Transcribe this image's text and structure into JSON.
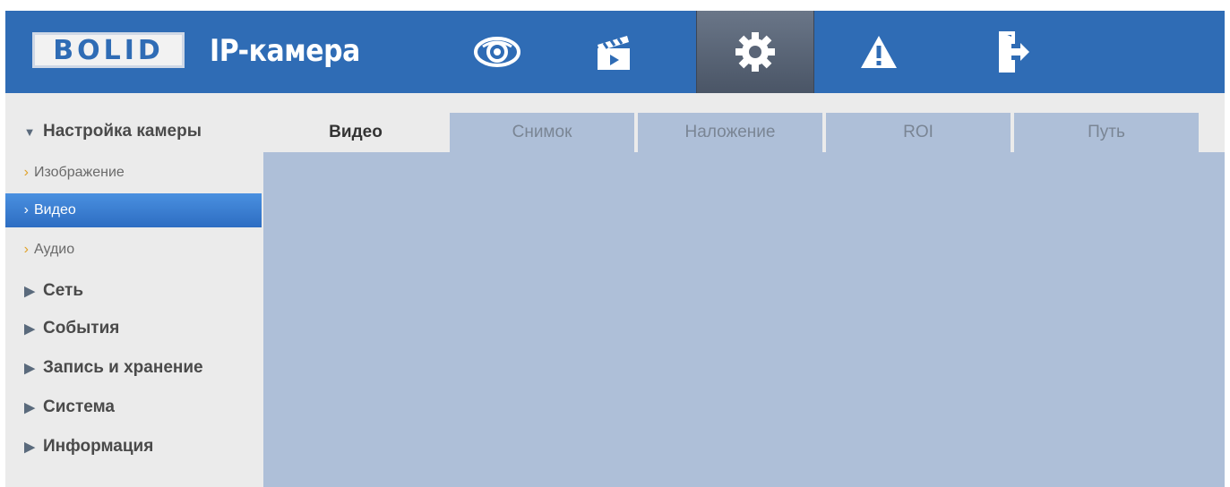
{
  "header": {
    "logo_text": "BOLID",
    "product_name": "IP-камера",
    "nav": [
      {
        "icon": "eye-icon",
        "active": false
      },
      {
        "icon": "clapperboard-icon",
        "active": false
      },
      {
        "icon": "gear-icon",
        "active": true
      },
      {
        "icon": "warning-icon",
        "active": false
      },
      {
        "icon": "logout-icon",
        "active": false
      }
    ]
  },
  "sidebar": {
    "items": [
      {
        "label": "Настройка камеры",
        "expanded": true,
        "children": [
          {
            "label": "Изображение",
            "selected": false
          },
          {
            "label": "Видео",
            "selected": true
          },
          {
            "label": "Аудио",
            "selected": false
          }
        ]
      },
      {
        "label": "Сеть",
        "expanded": false
      },
      {
        "label": "События",
        "expanded": false
      },
      {
        "label": "Запись и хранение",
        "expanded": false
      },
      {
        "label": "Система",
        "expanded": false
      },
      {
        "label": "Информация",
        "expanded": false
      }
    ]
  },
  "tabs": [
    {
      "label": "Видео",
      "active": true
    },
    {
      "label": "Снимок",
      "active": false
    },
    {
      "label": "Наложение",
      "active": false
    },
    {
      "label": "ROI",
      "active": false
    },
    {
      "label": "Путь",
      "active": false
    }
  ],
  "colors": {
    "header_bg": "#2f6cb5",
    "content_bg": "#aebfd8",
    "selected_item": "#2d6dc2"
  }
}
